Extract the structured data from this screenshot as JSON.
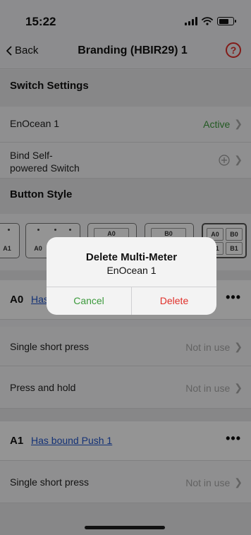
{
  "status_bar": {
    "time": "15:22",
    "icons": [
      "signal-icon",
      "wifi-icon",
      "battery-icon"
    ]
  },
  "nav": {
    "back_label": "Back",
    "title": "Branding (HBIR29) 1",
    "help_icon": "help-circle-icon"
  },
  "switch_settings": {
    "header": "Switch Settings",
    "enocean_label": "EnOcean 1",
    "enocean_status": "Active",
    "bind_label_line1": "Bind Self-",
    "bind_label_line2": "powered Switch"
  },
  "button_style": {
    "header": "Button Style",
    "option_labels": [
      "A1",
      "A0",
      "A0",
      "B0",
      "A0",
      "B0",
      "A1",
      "B1"
    ]
  },
  "keys": [
    {
      "id": "A0",
      "link": "Has bound Push 1",
      "actions": [
        {
          "label": "Single short press",
          "value": "Not in use"
        },
        {
          "label": "Press and hold",
          "value": "Not in use"
        }
      ]
    },
    {
      "id": "A1",
      "link": "Has bound Push 1",
      "actions": [
        {
          "label": "Single short press",
          "value": "Not in use"
        }
      ]
    }
  ],
  "dialog": {
    "title": "Delete Multi-Meter",
    "message": "EnOcean 1",
    "cancel_label": "Cancel",
    "delete_label": "Delete"
  },
  "colors": {
    "accent_green": "#3c9a3c",
    "danger_red": "#e0302a",
    "link_blue": "#2255cc"
  }
}
